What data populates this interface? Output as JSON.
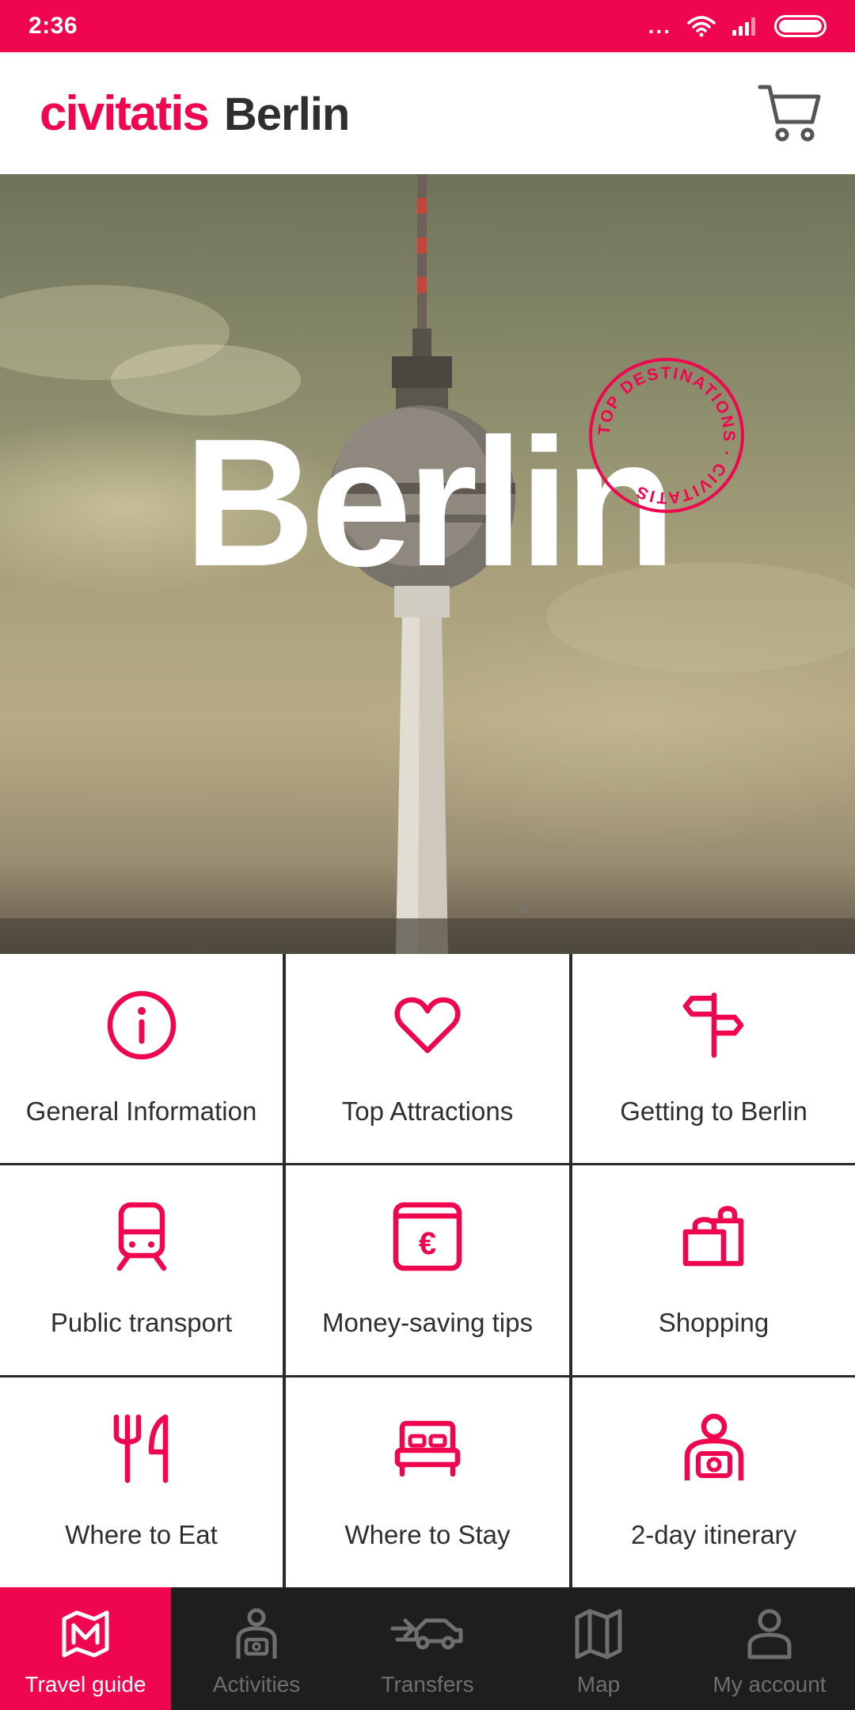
{
  "status_bar": {
    "time": "2:36",
    "dots": "...",
    "icons": [
      "wifi-icon",
      "cellular-signal-icon",
      "battery-icon"
    ]
  },
  "header": {
    "logo": "civitatis",
    "city": "Berlin",
    "cart_icon": "shopping-cart-icon"
  },
  "hero": {
    "title": "Berlin",
    "stamp_text": "TOP DESTINATIONS · CIVITATIS"
  },
  "menu": [
    {
      "label": "General Information",
      "icon": "info-icon"
    },
    {
      "label": "Top Attractions",
      "icon": "heart-icon"
    },
    {
      "label": "Getting to Berlin",
      "icon": "signpost-icon"
    },
    {
      "label": "Public transport",
      "icon": "train-icon"
    },
    {
      "label": "Money-saving tips",
      "icon": "euro-wallet-icon"
    },
    {
      "label": "Shopping",
      "icon": "shopping-bags-icon"
    },
    {
      "label": "Where to Eat",
      "icon": "fork-knife-icon"
    },
    {
      "label": "Where to Stay",
      "icon": "bed-icon"
    },
    {
      "label": "2-day itinerary",
      "icon": "tourist-camera-icon"
    }
  ],
  "bottom_nav": [
    {
      "label": "Travel guide",
      "icon": "map-m-icon",
      "active": true
    },
    {
      "label": "Activities",
      "icon": "backpacker-icon",
      "active": false
    },
    {
      "label": "Transfers",
      "icon": "car-transfer-icon",
      "active": false
    },
    {
      "label": "Map",
      "icon": "folded-map-icon",
      "active": false
    },
    {
      "label": "My account",
      "icon": "user-icon",
      "active": false
    }
  ],
  "colors": {
    "brand": "#f0064f",
    "text": "#2f2f2f",
    "nav_background": "#1f1e1e",
    "nav_inactive": "#6f6f6f"
  }
}
